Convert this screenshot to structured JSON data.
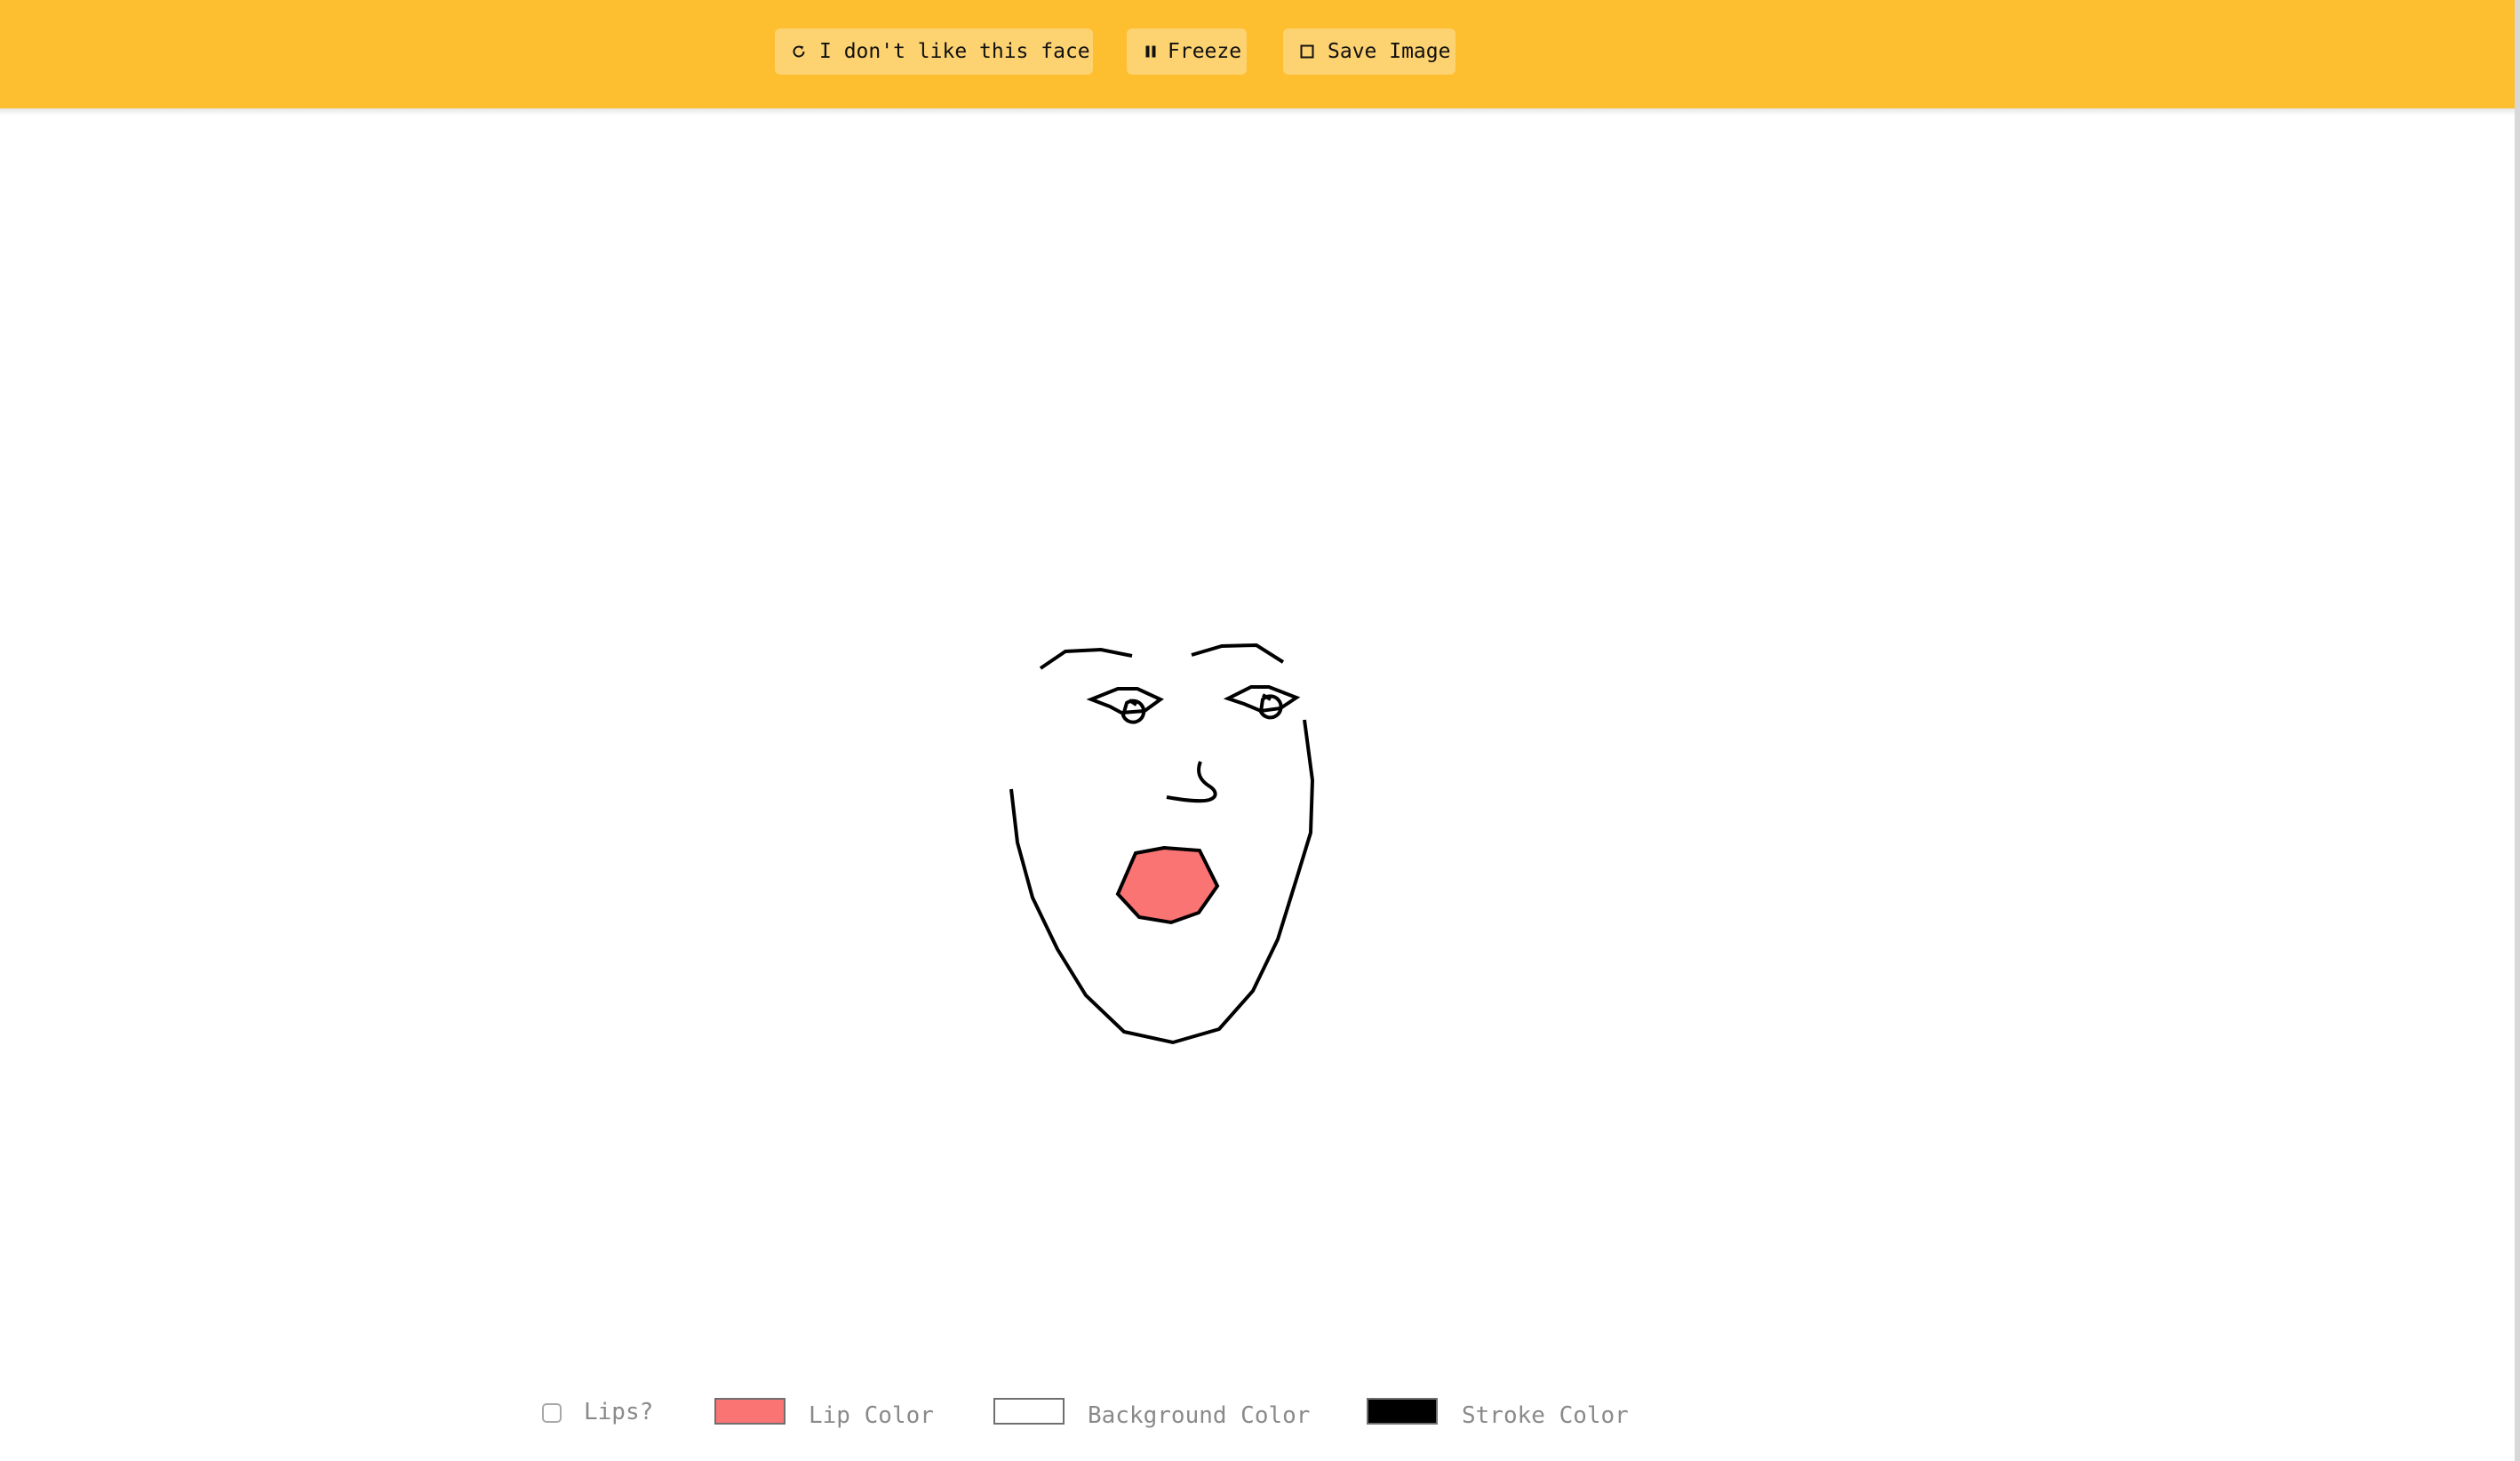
{
  "toolbar": {
    "buttons": [
      {
        "label": "I don't like this face",
        "icon": "refresh-icon"
      },
      {
        "label": "Freeze",
        "icon": "pause-icon"
      },
      {
        "label": "Save Image",
        "icon": "square-icon"
      }
    ],
    "background_color": "#fdbe30",
    "button_color": "#fdd271"
  },
  "canvas": {
    "background_color": "#ffffff",
    "stroke_color": "#000000",
    "lip_color": "#fb7474"
  },
  "controls": {
    "lips_label": "Lips?",
    "lips_checked": false,
    "lip_color_label": "Lip Color",
    "lip_color": "#fb7474",
    "background_color_label": "Background Color",
    "background_color": "#ffffff",
    "stroke_color_label": "Stroke Color",
    "stroke_color": "#000000"
  }
}
